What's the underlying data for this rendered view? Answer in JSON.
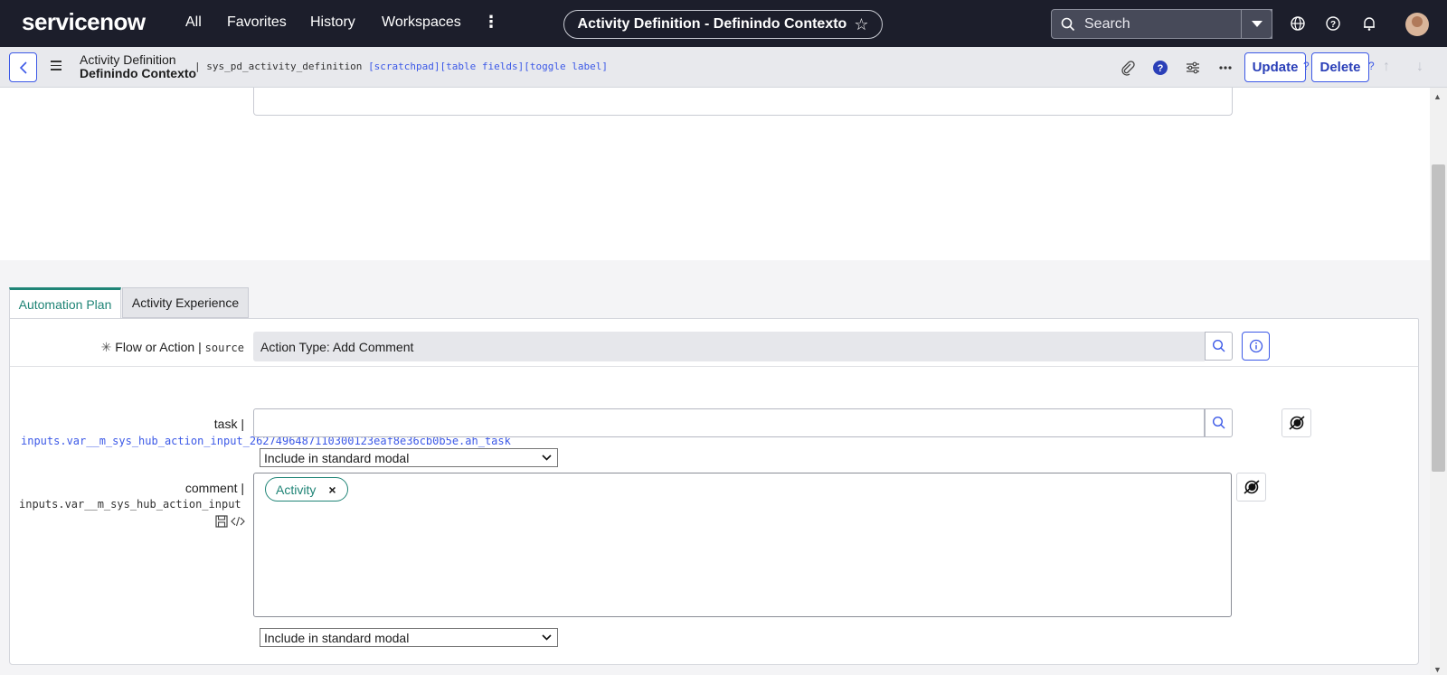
{
  "topnav": {
    "logo": "servicenow",
    "items": [
      "All",
      "Favorites",
      "History",
      "Workspaces"
    ],
    "record_title": "Activity Definition - Definindo Contexto",
    "search_placeholder": "Search"
  },
  "form_header": {
    "title_line1": "Activity Definition",
    "title_line2": "Definindo Contexto",
    "table_name": "| sys_pd_activity_definition",
    "table_links": "[scratchpad][table fields][toggle label]",
    "update_label": "Update",
    "delete_label": "Delete",
    "help_mark": "?"
  },
  "tabs": [
    {
      "label": "Automation Plan",
      "active": true
    },
    {
      "label": "Activity Experience",
      "active": false
    }
  ],
  "fields": {
    "source": {
      "label": "Flow or Action",
      "separator": " | ",
      "name": "source",
      "required_mark": "✳",
      "value": "Action Type: Add Comment"
    },
    "task": {
      "label": "task |",
      "name": "inputs.var__m_sys_hub_action_input_2627496487110300123eaf8e36cb0b5e.ah_task",
      "modal_option": "Include in standard modal"
    },
    "comment": {
      "label": "comment |",
      "name": "inputs.var__m_sys_hub_action_input",
      "chip": "Activity",
      "chip_remove": "×",
      "modal_option": "Include in standard modal"
    }
  }
}
